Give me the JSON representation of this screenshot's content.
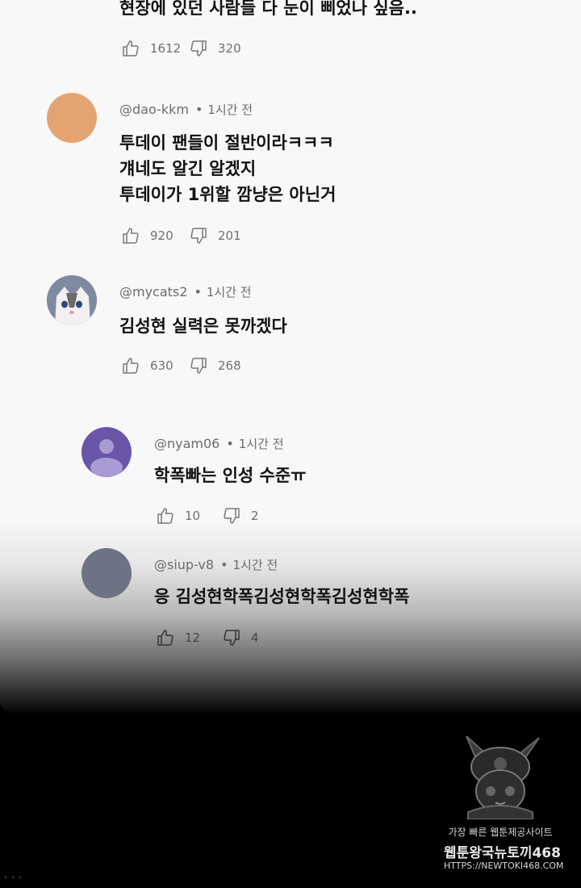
{
  "comments": [
    {
      "lines": [
        "현장에 있던 사람들 다 눈이 삐었나 싶음.."
      ],
      "likes": "1612",
      "dislikes": "320"
    },
    {
      "handle": "@dao-kkm",
      "time": "1시간 전",
      "avatar_color": "#e4a472",
      "lines": [
        "투데이 팬들이 절반이라ㅋㅋㅋ",
        "걔네도 알긴 알겠지",
        "투데이가 1위할 깜냥은 아닌거"
      ],
      "likes": "920",
      "dislikes": "201"
    },
    {
      "handle": "@mycats2",
      "time": "1시간 전",
      "avatar_color": "#8f9bb0",
      "lines": [
        "김성현 실력은 못까겠다"
      ],
      "likes": "630",
      "dislikes": "268"
    },
    {
      "handle": "@nyam06",
      "time": "1시간 전",
      "avatar_color": "#6b55a8",
      "lines": [
        "학폭빠는 인성 수준ㅠ"
      ],
      "likes": "10",
      "dislikes": "2"
    },
    {
      "handle": "@siup-v8",
      "time": "1시간 전",
      "avatar_color": "#6e7285",
      "lines": [
        "응 김성현학폭김성현학폭김성현학폭"
      ],
      "likes": "12",
      "dislikes": "4"
    }
  ],
  "icons": {
    "like": "thumbs-up-icon",
    "dislike": "thumbs-down-icon",
    "default_avatar": "person-icon"
  },
  "watermark": {
    "line1": "가장 빠른 웹툰제공사이트",
    "line2": "웹툰왕국뉴토끼468",
    "line3": "HTTPS://NEWTOKI468.COM"
  }
}
